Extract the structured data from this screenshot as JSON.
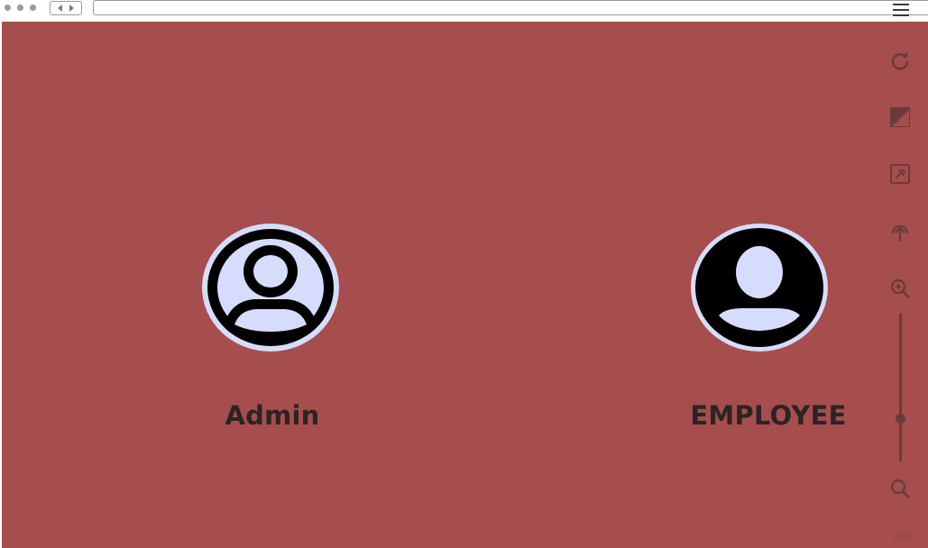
{
  "window": {
    "url": ""
  },
  "roles": [
    {
      "id": "admin",
      "label": "Admin",
      "icon": "user-outline-icon"
    },
    {
      "id": "employee",
      "label": "EMPLOYEE",
      "icon": "user-filled-icon"
    }
  ],
  "toolbar": {
    "tools": [
      "refresh-icon",
      "contrast-icon",
      "pin-icon",
      "upload-icon",
      "zoom-in-icon",
      "zoom-out-icon"
    ],
    "zoom_level": "100%",
    "zoom_value": 0.3
  },
  "colors": {
    "background": "#a64d4d",
    "label": "#2b2424",
    "avatar_fill": "#d6dcfb",
    "avatar_dark": "#000000",
    "toolbar_icon": "#6b3b3b"
  }
}
